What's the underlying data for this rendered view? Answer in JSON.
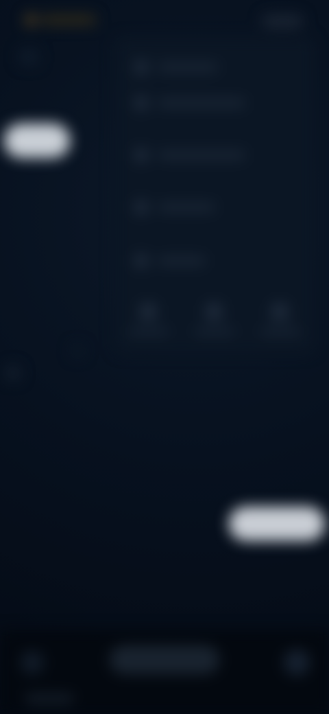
{
  "colors": {
    "background": "#050c17",
    "panel": "#0b1624",
    "accent_light": "#c9cfd6",
    "logo_accent": "#4a3b20"
  },
  "icons": {
    "logo": "logo-icon",
    "menu": "hamburger-menu-icon",
    "panel_items": [
      "menu-item-icon",
      "menu-item-icon",
      "menu-item-icon",
      "menu-item-icon",
      "menu-item-icon"
    ],
    "panel_actions": [
      "action-icon",
      "action-icon",
      "action-icon"
    ],
    "bottom_left": "round-icon",
    "bottom_right": "round-icon"
  }
}
